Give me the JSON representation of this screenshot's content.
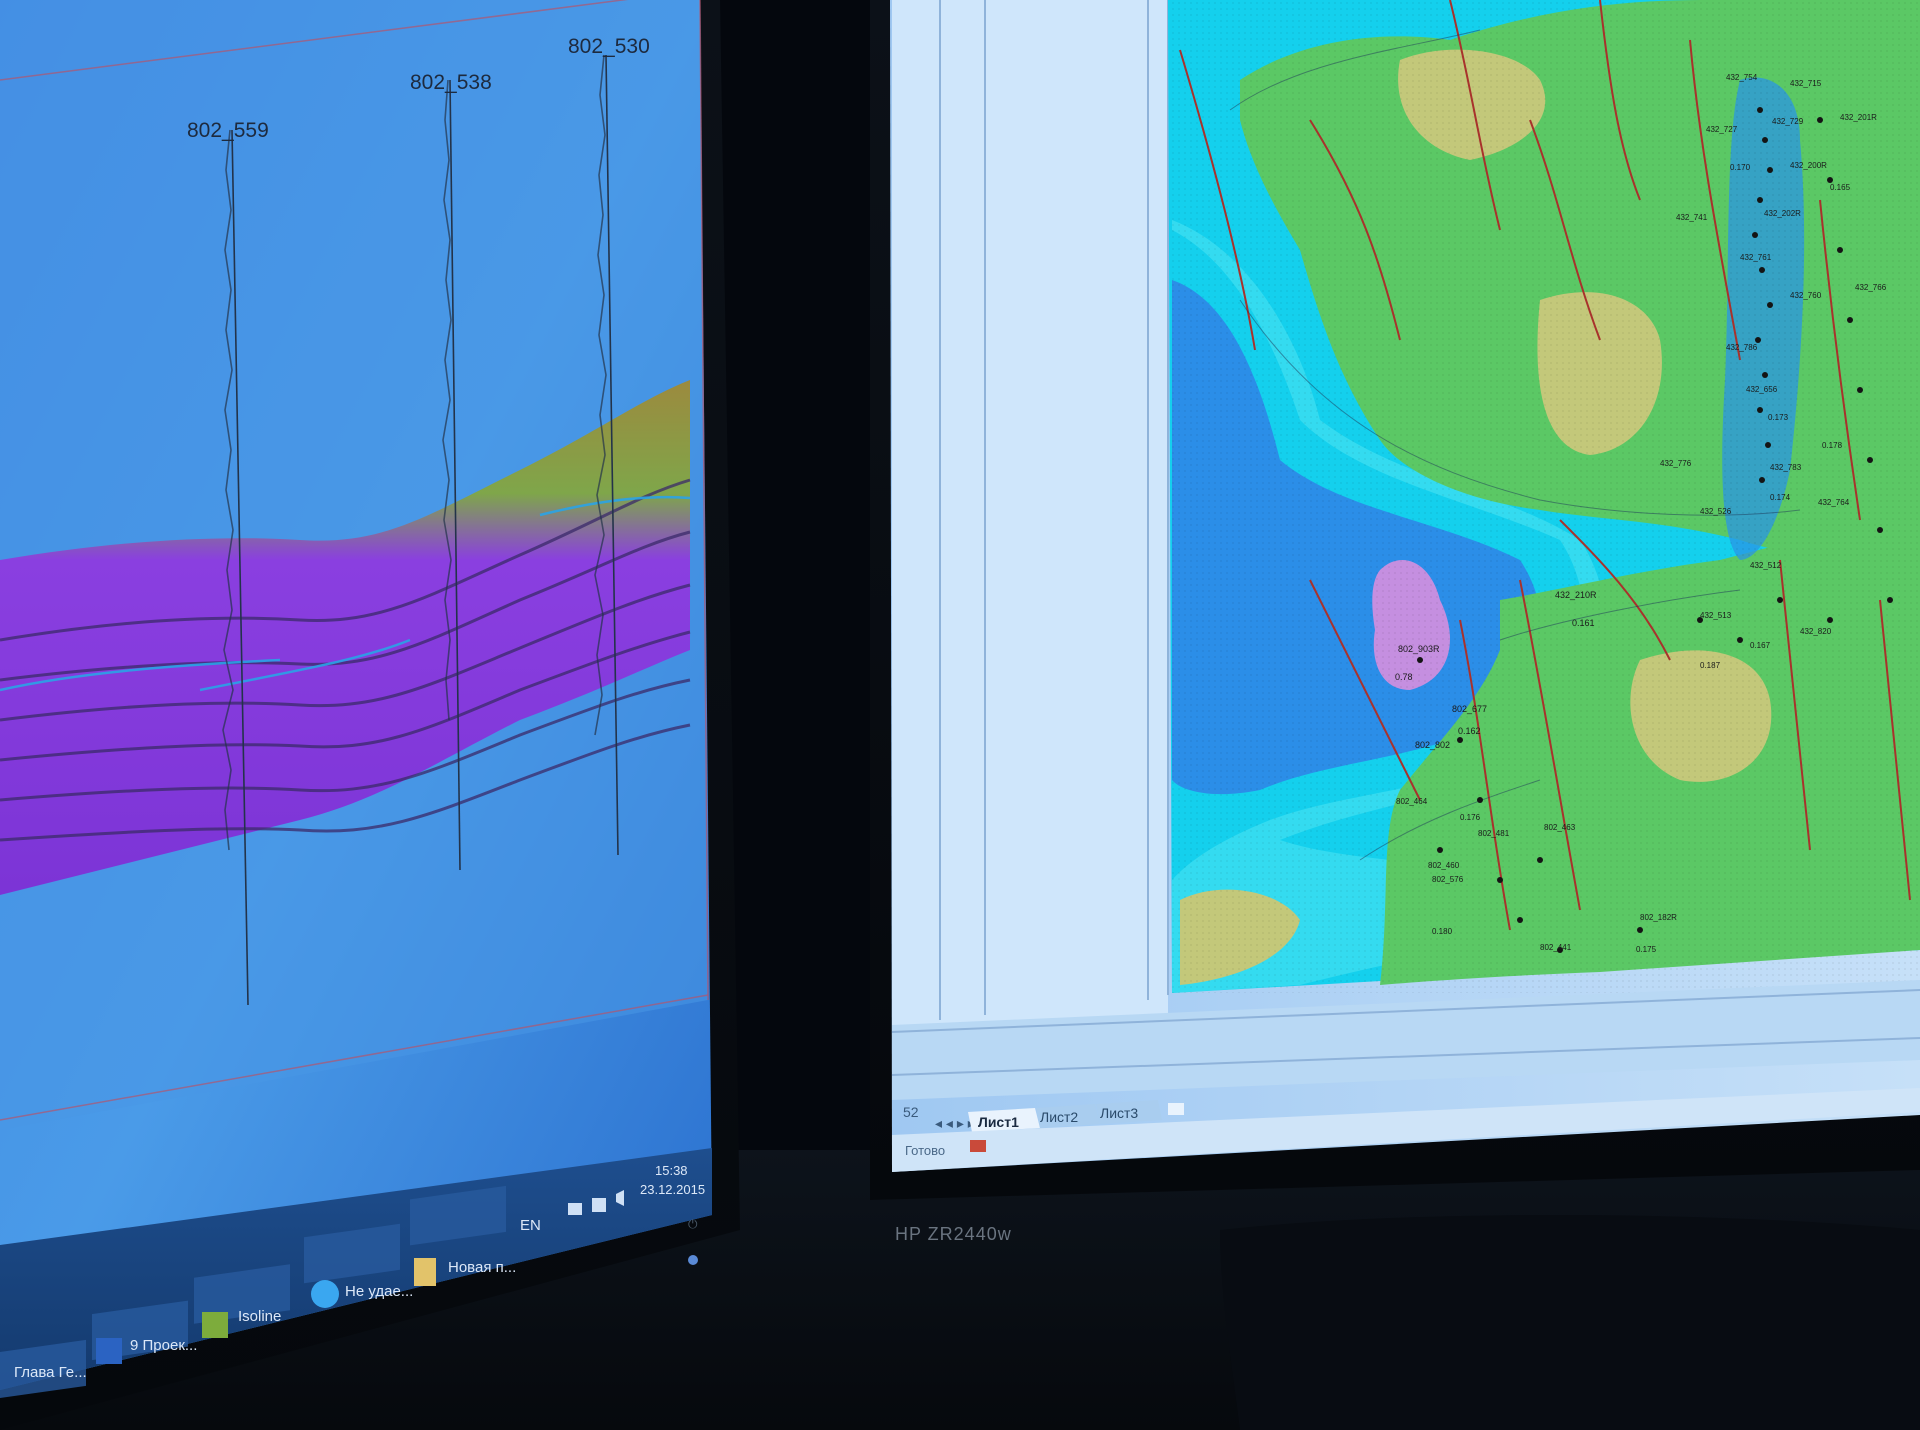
{
  "left_monitor": {
    "well_labels": [
      "802_559",
      "802_538",
      "802_530"
    ],
    "taskbar": {
      "language": "EN",
      "time": "15:38",
      "date": "23.12.2015",
      "items": [
        "Глава Ге...",
        "9 Проек...",
        "Isoline",
        "Не удае...",
        "Новая п..."
      ]
    }
  },
  "right_monitor": {
    "brand": "HP ZR2440w",
    "sheet_tabs": [
      "Лист1",
      "Лист2",
      "Лист3"
    ],
    "status": "Готово",
    "row_number": "52",
    "map_labels": {
      "lake_well": "802_903R",
      "lake_value": "0.78",
      "south_well": "802_677",
      "south_value": "0.162",
      "west_well": "802_802",
      "mid_well": "432_210R",
      "mid_value": "0.161",
      "cluster_1": "432_754",
      "cluster_2": "432_715",
      "cluster_3": "432_727",
      "cluster_4": "432_201R",
      "cluster_5": "432_729",
      "cluster_6": "432_200R",
      "cluster_7": "432_741",
      "cluster_8": "432_202R",
      "cluster_9": "432_761",
      "cluster_10": "432_760",
      "cluster_11": "432_766",
      "cluster_12": "432_786",
      "cluster_13": "432_656",
      "cluster_14": "432_776",
      "cluster_15": "432_783",
      "cluster_16": "432_764",
      "cluster_17": "432_526",
      "cluster_18": "432_512",
      "cluster_19": "432_513",
      "cluster_20": "432_820",
      "low_1": "802_464",
      "low_2": "802_463",
      "low_3": "802_481",
      "low_4": "802_460",
      "low_5": "802_576",
      "low_6": "802_182R",
      "low_7": "802_441",
      "val_1": "0.170",
      "val_2": "0.165",
      "val_3": "0.173",
      "val_4": "0.178",
      "val_5": "0.174",
      "val_6": "0.187",
      "val_7": "0.167",
      "val_8": "0.176",
      "val_9": "0.180",
      "val_10": "0.175"
    }
  },
  "colors": {
    "seismic_magenta": "#8e3ae6",
    "seismic_green": "#8aa83a",
    "map_cyan": "#19d6ef",
    "map_green": "#56c86a",
    "map_khaki": "#bfc67c",
    "fault_red": "#a8322c"
  }
}
